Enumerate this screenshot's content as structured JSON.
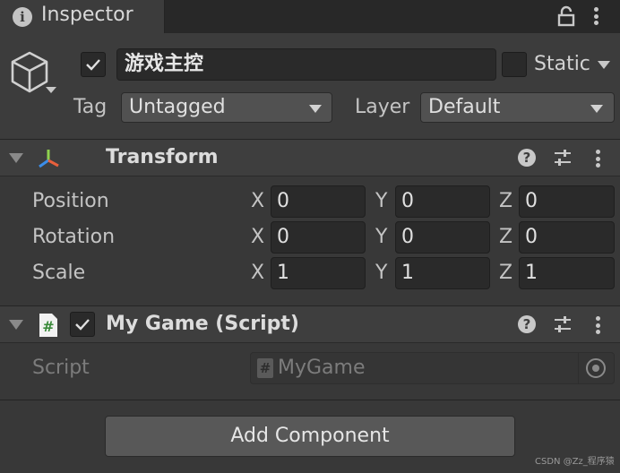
{
  "tab": {
    "title": "Inspector"
  },
  "header": {
    "active": true,
    "name": "游戏主控",
    "static": false,
    "static_label": "Static",
    "tag_label": "Tag",
    "tag_value": "Untagged",
    "layer_label": "Layer",
    "layer_value": "Default"
  },
  "transform": {
    "title": "Transform",
    "rows": [
      {
        "label": "Position",
        "x": "0",
        "y": "0",
        "z": "0"
      },
      {
        "label": "Rotation",
        "x": "0",
        "y": "0",
        "z": "0"
      },
      {
        "label": "Scale",
        "x": "1",
        "y": "1",
        "z": "1"
      }
    ],
    "axes": {
      "x": "X",
      "y": "Y",
      "z": "Z"
    }
  },
  "script_component": {
    "enabled": true,
    "title": "My Game (Script)",
    "script_label": "Script",
    "script_value": "MyGame"
  },
  "footer": {
    "add_component_label": "Add Component"
  },
  "watermark": "CSDN @Zz_程序猿",
  "colors": {
    "background": "#383838",
    "tab_bar": "#282828",
    "field": "#2a2a2a",
    "button": "#585858",
    "text": "#d2d2d2"
  },
  "icons": {
    "tab": "info-icon",
    "object": "cube-icon",
    "transform": "transform-axes-icon",
    "script": "csharp-script-icon",
    "help": "help-icon",
    "presets": "sliders-icon",
    "more": "kebab-menu-icon",
    "lock": "lock-icon",
    "object_picker": "target-icon"
  }
}
